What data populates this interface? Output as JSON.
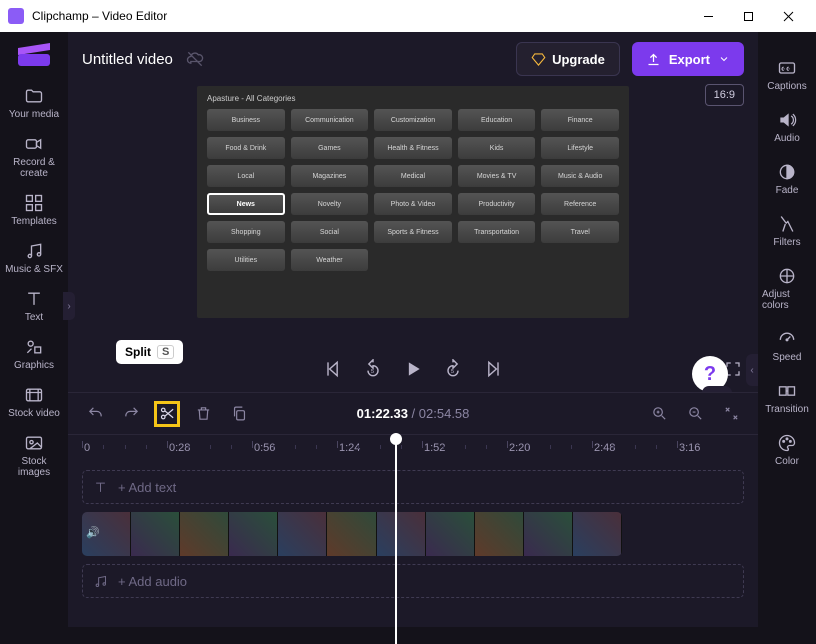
{
  "titlebar": {
    "app_title": "Clipchamp – Video Editor"
  },
  "header": {
    "video_title": "Untitled video",
    "upgrade_label": "Upgrade",
    "export_label": "Export",
    "aspect_label": "16:9"
  },
  "left_sidebar": {
    "items": [
      {
        "label": "Your media"
      },
      {
        "label": "Record & create"
      },
      {
        "label": "Templates"
      },
      {
        "label": "Music & SFX"
      },
      {
        "label": "Text"
      },
      {
        "label": "Graphics"
      },
      {
        "label": "Stock video"
      },
      {
        "label": "Stock images"
      }
    ]
  },
  "right_sidebar": {
    "items": [
      {
        "label": "Captions"
      },
      {
        "label": "Audio"
      },
      {
        "label": "Fade"
      },
      {
        "label": "Filters"
      },
      {
        "label": "Adjust colors"
      },
      {
        "label": "Speed"
      },
      {
        "label": "Transition"
      },
      {
        "label": "Color"
      }
    ]
  },
  "preview_content": {
    "heading": "Apasture - All Categories",
    "categories": [
      "Business",
      "Communication",
      "Customization",
      "Education",
      "Finance",
      "Food & Drink",
      "Games",
      "Health & Fitness",
      "Kids",
      "Lifestyle",
      "Local",
      "Magazines",
      "Medical",
      "Movies & TV",
      "Music & Audio",
      "News",
      "Novelty",
      "Photo & Video",
      "Productivity",
      "Reference",
      "Shopping",
      "Social",
      "Sports & Fitness",
      "Transportation",
      "Travel",
      "Utilities",
      "Weather"
    ],
    "selected_index": 15
  },
  "tooltip": {
    "label": "Split",
    "shortcut": "S"
  },
  "timecode": {
    "current": "01:22.33",
    "total": "02:54.58"
  },
  "ruler": {
    "labels": [
      "0",
      "0:28",
      "0:56",
      "1:24",
      "1:52",
      "2:20",
      "2:48",
      "3:16"
    ]
  },
  "tracks": {
    "add_text": "+  Add text",
    "add_audio": "+  Add audio"
  },
  "help_label": "?",
  "colors": {
    "accent": "#7c3aed",
    "highlight": "#f5c518"
  }
}
